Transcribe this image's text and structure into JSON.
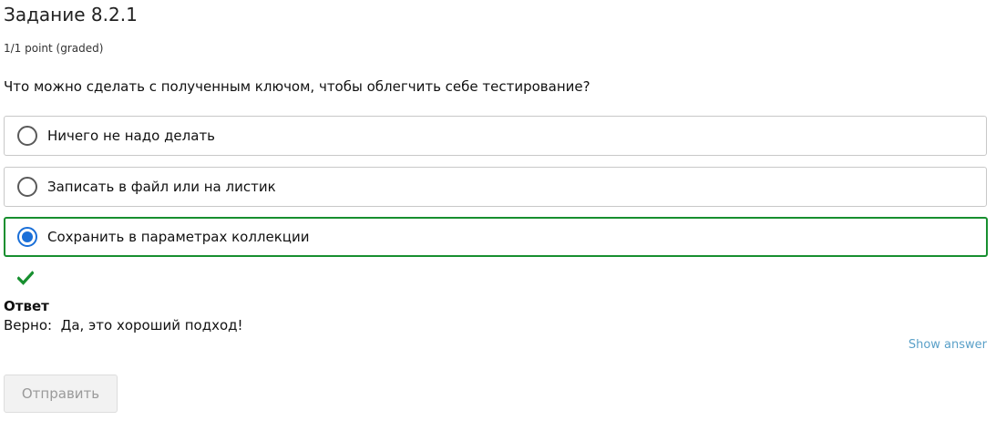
{
  "problem": {
    "title": "Задание 8.2.1",
    "points": "1/1 point (graded)",
    "question": "Что можно сделать с полученным ключом, чтобы облегчить себе тестирование?"
  },
  "choices": [
    {
      "label": "Ничего не надо делать",
      "selected": false
    },
    {
      "label": "Записать в файл или на листик",
      "selected": false
    },
    {
      "label": "Сохранить в параметрах коллекции",
      "selected": true,
      "status": "correct"
    }
  ],
  "feedback": {
    "icon": "checkmark-icon",
    "heading": "Ответ",
    "text": "Верно:  Да, это хороший подход!"
  },
  "actions": {
    "show_answer": "Show answer",
    "submit": "Отправить"
  },
  "colors": {
    "correct": "#178f2f",
    "radio_selected": "#1a6fd8",
    "link": "#5aa0c8",
    "button_disabled_text": "#9a9a9a"
  }
}
